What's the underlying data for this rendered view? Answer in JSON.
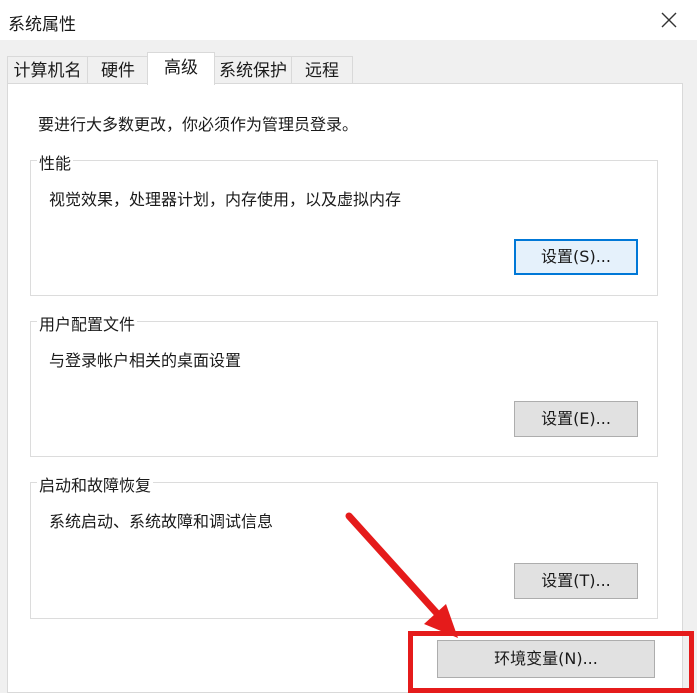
{
  "window": {
    "title": "系统属性",
    "close_icon": "close-icon"
  },
  "tabs": [
    {
      "label": "计算机名",
      "active": false
    },
    {
      "label": "硬件",
      "active": false
    },
    {
      "label": "高级",
      "active": true
    },
    {
      "label": "系统保护",
      "active": false
    },
    {
      "label": "远程",
      "active": false
    }
  ],
  "notice": "要进行大多数更改，你必须作为管理员登录。",
  "groups": {
    "performance": {
      "title": "性能",
      "description": "视觉效果，处理器计划，内存使用，以及虚拟内存",
      "button": "设置(S)..."
    },
    "user_profiles": {
      "title": "用户配置文件",
      "description": "与登录帐户相关的桌面设置",
      "button": "设置(E)..."
    },
    "startup_recovery": {
      "title": "启动和故障恢复",
      "description": "系统启动、系统故障和调试信息",
      "button": "设置(T)..."
    }
  },
  "env_button": "环境变量(N)...",
  "colors": {
    "annotation_red": "#e51b1b",
    "focus_blue": "#0078d7"
  }
}
